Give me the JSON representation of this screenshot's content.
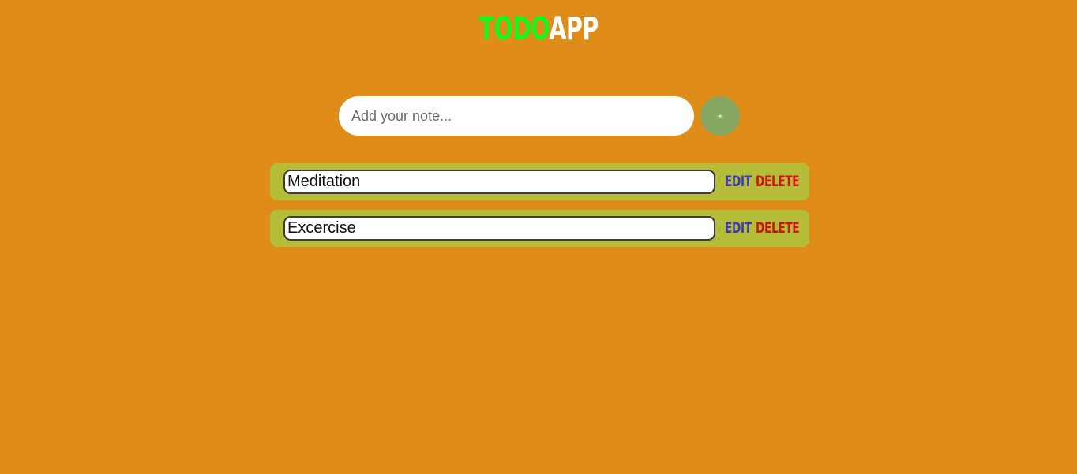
{
  "header": {
    "title_part1": "TODO",
    "title_part2": "APP"
  },
  "add_form": {
    "placeholder": "Add your note...",
    "value": "",
    "add_label": "+"
  },
  "todos": [
    {
      "text": "Meditation",
      "edit_label": "EDIT",
      "delete_label": "DELETE"
    },
    {
      "text": "Excercise",
      "edit_label": "EDIT",
      "delete_label": "DELETE"
    }
  ],
  "colors": {
    "background": "#df8c18",
    "title_accent": "#19f51d",
    "title_main": "#ffffff",
    "add_button": "#86a762",
    "item_background": "#b5bd38",
    "edit": "#3d3ab1",
    "delete": "#cf1313"
  }
}
